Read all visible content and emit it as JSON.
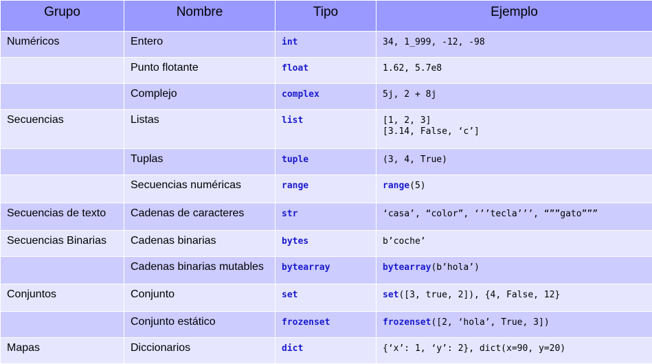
{
  "headers": {
    "group": "Grupo",
    "name": "Nombre",
    "type": "Tipo",
    "example": "Ejemplo"
  },
  "rows": [
    {
      "group": "Numéricos",
      "name": "Entero",
      "type": "int",
      "example": "34, 1_999, -12, -98"
    },
    {
      "group": "",
      "name": "Punto flotante",
      "type": "float",
      "example": "1.62, 5.7e8"
    },
    {
      "group": "",
      "name": "Complejo",
      "type": "complex",
      "example": "5j, 2 + 8j"
    },
    {
      "group": "Secuencias",
      "name": "Listas",
      "type": "list",
      "example_line1": "[1, 2, 3]",
      "example_line2": "[3.14, False, ‘c’]"
    },
    {
      "group": "",
      "name": "Tuplas",
      "type": "tuple",
      "example": "(3, 4, True)"
    },
    {
      "group": "",
      "name": "Secuencias numéricas",
      "type": "range",
      "example_kw": "range",
      "example_rest": "(5)"
    },
    {
      "group": "Secuencias de texto",
      "name": "Cadenas de caracteres",
      "type": "str",
      "example": "‘casa’, “color”, ‘’’tecla’’’, “””gato”””"
    },
    {
      "group": "Secuencias Binarias",
      "name": "Cadenas binarias",
      "type": "bytes",
      "example": "b’coche’"
    },
    {
      "group": "",
      "name": "Cadenas binarias mutables",
      "type": "bytearray",
      "example_kw": "bytearray",
      "example_rest": "(b’hola’)"
    },
    {
      "group": "Conjuntos",
      "name": "Conjunto",
      "type": "set",
      "example_kw": "set",
      "example_rest": "([3, true, 2]), {4, False, 12}"
    },
    {
      "group": "",
      "name": "Conjunto estático",
      "type": "frozenset",
      "example_kw": "frozenset",
      "example_rest": "([2, ‘hola’, True, 3])"
    },
    {
      "group": "Mapas",
      "name": "Diccionarios",
      "type": "dict",
      "example": "{‘x’: 1, ‘y’: 2}, dict(x=90, y=20)"
    }
  ],
  "colors": {
    "header": "#9999ff",
    "row_dark": "#ccccff",
    "row_light": "#e6e6ff",
    "keyword": "#1a1acc"
  }
}
